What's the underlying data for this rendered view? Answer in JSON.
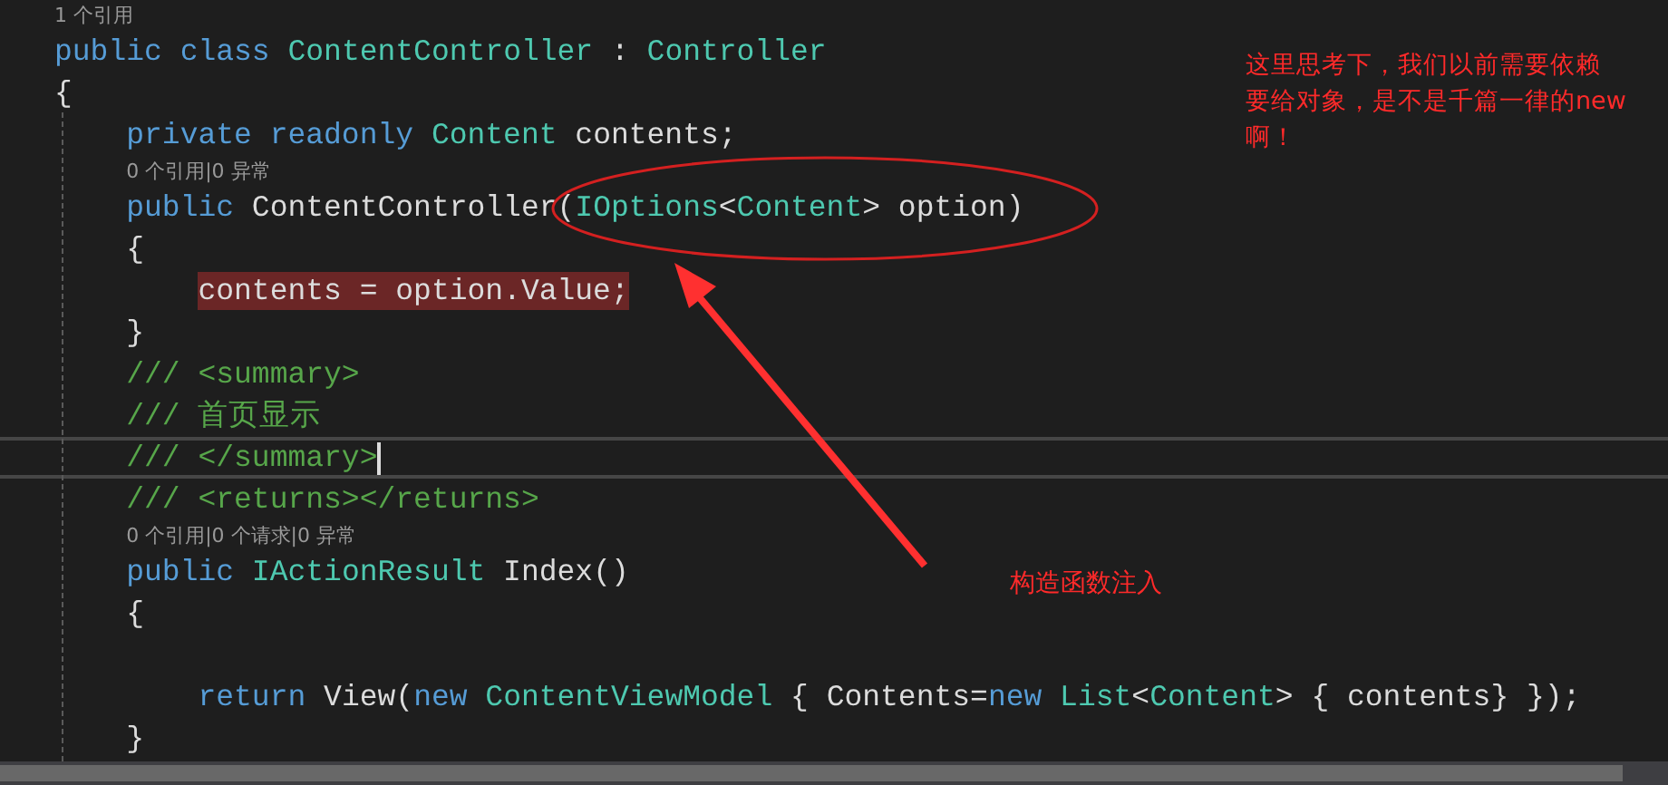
{
  "editor": {
    "lines": [
      {
        "kind": "code",
        "lens": "1 个引用",
        "tokens": [
          {
            "kind": "keyword",
            "text": "public"
          },
          {
            "kind": "keyword",
            "text": " class"
          },
          {
            "kind": "type",
            "text": " ContentController"
          },
          {
            "kind": "plain",
            "text": " : "
          },
          {
            "kind": "type",
            "text": "Controller"
          }
        ]
      },
      {
        "kind": "code",
        "tokens": [
          {
            "kind": "plain",
            "text": "{"
          }
        ]
      },
      {
        "kind": "code",
        "tokens": [
          {
            "kind": "keyword",
            "text": "    private"
          },
          {
            "kind": "keyword",
            "text": " readonly"
          },
          {
            "kind": "type",
            "text": " Content"
          },
          {
            "kind": "plain",
            "text": " contents;"
          }
        ]
      },
      {
        "kind": "code",
        "lens": "0 个引用|0 异常",
        "tokens": [
          {
            "kind": "keyword",
            "text": "    public"
          },
          {
            "kind": "plain",
            "text": " ContentController("
          },
          {
            "kind": "type",
            "text": "IOptions"
          },
          {
            "kind": "plain",
            "text": "<"
          },
          {
            "kind": "type",
            "text": "Content"
          },
          {
            "kind": "plain",
            "text": "> option)"
          }
        ]
      },
      {
        "kind": "code",
        "tokens": [
          {
            "kind": "plain",
            "text": "    {"
          }
        ]
      },
      {
        "kind": "code",
        "highlighted": true,
        "tokens": [
          {
            "kind": "plain",
            "text": "        contents = option.Value;"
          }
        ]
      },
      {
        "kind": "code",
        "tokens": [
          {
            "kind": "plain",
            "text": "    }"
          }
        ]
      },
      {
        "kind": "code",
        "tokens": [
          {
            "kind": "comment",
            "text": "    /// <summary>"
          }
        ]
      },
      {
        "kind": "code",
        "tokens": [
          {
            "kind": "comment",
            "text": "    /// 首页显示"
          }
        ]
      },
      {
        "kind": "code",
        "current": true,
        "tokens": [
          {
            "kind": "comment",
            "text": "    /// </summary>"
          }
        ]
      },
      {
        "kind": "code",
        "tokens": [
          {
            "kind": "comment",
            "text": "    /// <returns></returns>"
          }
        ]
      },
      {
        "kind": "code",
        "lens": "0 个引用|0 个请求|0 异常",
        "tokens": [
          {
            "kind": "keyword",
            "text": "    public"
          },
          {
            "kind": "type",
            "text": " IActionResult"
          },
          {
            "kind": "plain",
            "text": " Index()"
          }
        ]
      },
      {
        "kind": "code",
        "tokens": [
          {
            "kind": "plain",
            "text": "    {"
          }
        ]
      },
      {
        "kind": "blank"
      },
      {
        "kind": "code",
        "tokens": [
          {
            "kind": "keyword",
            "text": "        return"
          },
          {
            "kind": "plain",
            "text": " View("
          },
          {
            "kind": "keyword",
            "text": "new"
          },
          {
            "kind": "type",
            "text": " ContentViewModel"
          },
          {
            "kind": "plain",
            "text": " { Contents="
          },
          {
            "kind": "keyword",
            "text": "new"
          },
          {
            "kind": "type",
            "text": " List"
          },
          {
            "kind": "plain",
            "text": "<"
          },
          {
            "kind": "type",
            "text": "Content"
          },
          {
            "kind": "plain",
            "text": "> { contents} });"
          }
        ]
      },
      {
        "kind": "code",
        "tokens": [
          {
            "kind": "plain",
            "text": "    }"
          }
        ]
      }
    ]
  },
  "annotations": {
    "note": {
      "lines": [
        "这里思考下，我们以前需要依赖",
        "要给对象，是不是千篇一律的new",
        "啊！"
      ]
    },
    "label": "构造函数注入"
  }
}
